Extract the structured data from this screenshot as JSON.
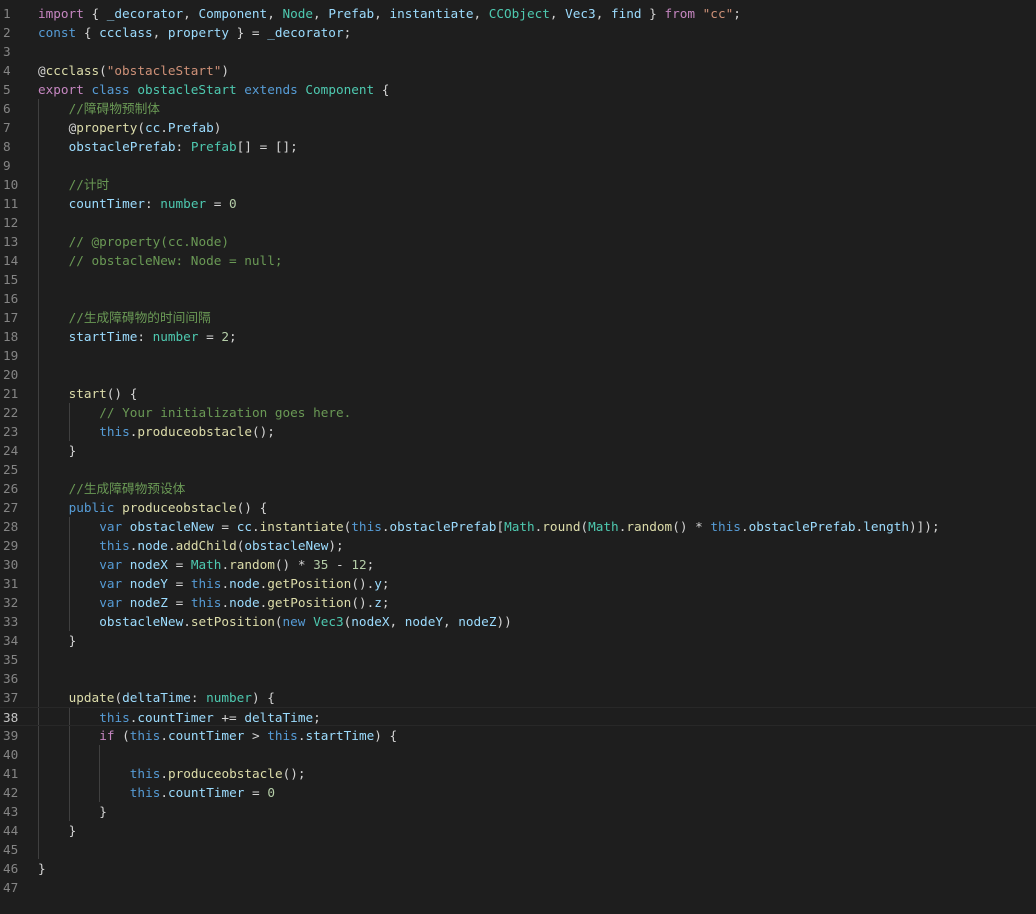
{
  "editor": {
    "language": "typescript",
    "current_line": 38,
    "theme_colors": {
      "background": "#1e1e1e",
      "keyword": "#569cd6",
      "control": "#c586c0",
      "string": "#ce9178",
      "variable": "#9cdcfe",
      "function": "#dcdcaa",
      "type": "#4ec9b0",
      "number": "#b5cea8",
      "comment": "#6a9955",
      "line_number": "#858585"
    },
    "lines": [
      {
        "n": "1",
        "indent": 0,
        "tokens": [
          [
            "import",
            "t-ctl"
          ],
          [
            " { ",
            "t-pun"
          ],
          [
            "_decorator",
            "t-var"
          ],
          [
            ", ",
            "t-pun"
          ],
          [
            "Component",
            "t-var"
          ],
          [
            ", ",
            "t-pun"
          ],
          [
            "Node",
            "t-type"
          ],
          [
            ", ",
            "t-pun"
          ],
          [
            "Prefab",
            "t-var"
          ],
          [
            ", ",
            "t-pun"
          ],
          [
            "instantiate",
            "t-var"
          ],
          [
            ", ",
            "t-pun"
          ],
          [
            "CCObject",
            "t-type"
          ],
          [
            ", ",
            "t-pun"
          ],
          [
            "Vec3",
            "t-var"
          ],
          [
            ", ",
            "t-pun"
          ],
          [
            "find",
            "t-var"
          ],
          [
            " } ",
            "t-pun"
          ],
          [
            "from",
            "t-ctl"
          ],
          [
            " ",
            "t-pun"
          ],
          [
            "\"cc\"",
            "t-str"
          ],
          [
            ";",
            "t-pun"
          ]
        ]
      },
      {
        "n": "2",
        "indent": 0,
        "tokens": [
          [
            "const",
            "t-kw"
          ],
          [
            " { ",
            "t-pun"
          ],
          [
            "ccclass",
            "t-var"
          ],
          [
            ", ",
            "t-pun"
          ],
          [
            "property",
            "t-var"
          ],
          [
            " } = ",
            "t-pun"
          ],
          [
            "_decorator",
            "t-var"
          ],
          [
            ";",
            "t-pun"
          ]
        ]
      },
      {
        "n": "3",
        "indent": 0,
        "tokens": []
      },
      {
        "n": "4",
        "indent": 0,
        "tokens": [
          [
            "@",
            "t-pun"
          ],
          [
            "ccclass",
            "t-fn"
          ],
          [
            "(",
            "t-pun"
          ],
          [
            "\"obstacleStart\"",
            "t-str"
          ],
          [
            ")",
            "t-pun"
          ]
        ]
      },
      {
        "n": "5",
        "indent": 0,
        "tokens": [
          [
            "export",
            "t-ctl"
          ],
          [
            " ",
            "t-pun"
          ],
          [
            "class",
            "t-kw"
          ],
          [
            " ",
            "t-pun"
          ],
          [
            "obstacleStart",
            "t-type"
          ],
          [
            " ",
            "t-pun"
          ],
          [
            "extends",
            "t-kw"
          ],
          [
            " ",
            "t-pun"
          ],
          [
            "Component",
            "t-type"
          ],
          [
            " {",
            "t-pun"
          ]
        ]
      },
      {
        "n": "6",
        "indent": 1,
        "tokens": [
          [
            "//障碍物预制体",
            "t-com"
          ]
        ]
      },
      {
        "n": "7",
        "indent": 1,
        "tokens": [
          [
            "@",
            "t-pun"
          ],
          [
            "property",
            "t-fn"
          ],
          [
            "(",
            "t-pun"
          ],
          [
            "cc",
            "t-var"
          ],
          [
            ".",
            "t-pun"
          ],
          [
            "Prefab",
            "t-var"
          ],
          [
            ")",
            "t-pun"
          ]
        ]
      },
      {
        "n": "8",
        "indent": 1,
        "tokens": [
          [
            "obstaclePrefab",
            "t-var"
          ],
          [
            ": ",
            "t-pun"
          ],
          [
            "Prefab",
            "t-type"
          ],
          [
            "[] = [];",
            "t-pun"
          ]
        ]
      },
      {
        "n": "9",
        "indent": 1,
        "tokens": []
      },
      {
        "n": "10",
        "indent": 1,
        "tokens": [
          [
            "//计时",
            "t-com"
          ]
        ]
      },
      {
        "n": "11",
        "indent": 1,
        "tokens": [
          [
            "countTimer",
            "t-var"
          ],
          [
            ": ",
            "t-pun"
          ],
          [
            "number",
            "t-type"
          ],
          [
            " = ",
            "t-pun"
          ],
          [
            "0",
            "t-num"
          ]
        ]
      },
      {
        "n": "12",
        "indent": 1,
        "tokens": []
      },
      {
        "n": "13",
        "indent": 1,
        "tokens": [
          [
            "// @property(cc.Node)",
            "t-com"
          ]
        ]
      },
      {
        "n": "14",
        "indent": 1,
        "tokens": [
          [
            "// obstacleNew: Node = null;",
            "t-com"
          ]
        ]
      },
      {
        "n": "15",
        "indent": 1,
        "tokens": []
      },
      {
        "n": "16",
        "indent": 1,
        "tokens": []
      },
      {
        "n": "17",
        "indent": 1,
        "tokens": [
          [
            "//生成障碍物的时间间隔",
            "t-com"
          ]
        ]
      },
      {
        "n": "18",
        "indent": 1,
        "tokens": [
          [
            "startTime",
            "t-var"
          ],
          [
            ": ",
            "t-pun"
          ],
          [
            "number",
            "t-type"
          ],
          [
            " = ",
            "t-pun"
          ],
          [
            "2",
            "t-num"
          ],
          [
            ";",
            "t-pun"
          ]
        ]
      },
      {
        "n": "19",
        "indent": 1,
        "tokens": []
      },
      {
        "n": "20",
        "indent": 1,
        "tokens": []
      },
      {
        "n": "21",
        "indent": 1,
        "tokens": [
          [
            "start",
            "t-fn"
          ],
          [
            "() {",
            "t-pun"
          ]
        ]
      },
      {
        "n": "22",
        "indent": 2,
        "tokens": [
          [
            "// Your initialization goes here.",
            "t-com"
          ]
        ]
      },
      {
        "n": "23",
        "indent": 2,
        "tokens": [
          [
            "this",
            "t-kw"
          ],
          [
            ".",
            "t-pun"
          ],
          [
            "produceobstacle",
            "t-fn"
          ],
          [
            "();",
            "t-pun"
          ]
        ]
      },
      {
        "n": "24",
        "indent": 1,
        "tokens": [
          [
            "}",
            "t-pun"
          ]
        ]
      },
      {
        "n": "25",
        "indent": 1,
        "tokens": []
      },
      {
        "n": "26",
        "indent": 1,
        "tokens": [
          [
            "//生成障碍物预设体",
            "t-com"
          ]
        ]
      },
      {
        "n": "27",
        "indent": 1,
        "tokens": [
          [
            "public",
            "t-kw"
          ],
          [
            " ",
            "t-pun"
          ],
          [
            "produceobstacle",
            "t-fn"
          ],
          [
            "() {",
            "t-pun"
          ]
        ]
      },
      {
        "n": "28",
        "indent": 2,
        "tokens": [
          [
            "var",
            "t-kw"
          ],
          [
            " ",
            "t-pun"
          ],
          [
            "obstacleNew",
            "t-var"
          ],
          [
            " = ",
            "t-pun"
          ],
          [
            "cc",
            "t-var"
          ],
          [
            ".",
            "t-pun"
          ],
          [
            "instantiate",
            "t-fn"
          ],
          [
            "(",
            "t-pun"
          ],
          [
            "this",
            "t-kw"
          ],
          [
            ".",
            "t-pun"
          ],
          [
            "obstaclePrefab",
            "t-var"
          ],
          [
            "[",
            "t-pun"
          ],
          [
            "Math",
            "t-type"
          ],
          [
            ".",
            "t-pun"
          ],
          [
            "round",
            "t-fn"
          ],
          [
            "(",
            "t-pun"
          ],
          [
            "Math",
            "t-type"
          ],
          [
            ".",
            "t-pun"
          ],
          [
            "random",
            "t-fn"
          ],
          [
            "() * ",
            "t-pun"
          ],
          [
            "this",
            "t-kw"
          ],
          [
            ".",
            "t-pun"
          ],
          [
            "obstaclePrefab",
            "t-var"
          ],
          [
            ".",
            "t-pun"
          ],
          [
            "length",
            "t-var"
          ],
          [
            ")]);",
            "t-pun"
          ]
        ]
      },
      {
        "n": "29",
        "indent": 2,
        "tokens": [
          [
            "this",
            "t-kw"
          ],
          [
            ".",
            "t-pun"
          ],
          [
            "node",
            "t-var"
          ],
          [
            ".",
            "t-pun"
          ],
          [
            "addChild",
            "t-fn"
          ],
          [
            "(",
            "t-pun"
          ],
          [
            "obstacleNew",
            "t-var"
          ],
          [
            ");",
            "t-pun"
          ]
        ]
      },
      {
        "n": "30",
        "indent": 2,
        "tokens": [
          [
            "var",
            "t-kw"
          ],
          [
            " ",
            "t-pun"
          ],
          [
            "nodeX",
            "t-var"
          ],
          [
            " = ",
            "t-pun"
          ],
          [
            "Math",
            "t-type"
          ],
          [
            ".",
            "t-pun"
          ],
          [
            "random",
            "t-fn"
          ],
          [
            "() * ",
            "t-pun"
          ],
          [
            "35",
            "t-num"
          ],
          [
            " - ",
            "t-pun"
          ],
          [
            "12",
            "t-num"
          ],
          [
            ";",
            "t-pun"
          ]
        ]
      },
      {
        "n": "31",
        "indent": 2,
        "tokens": [
          [
            "var",
            "t-kw"
          ],
          [
            " ",
            "t-pun"
          ],
          [
            "nodeY",
            "t-var"
          ],
          [
            " = ",
            "t-pun"
          ],
          [
            "this",
            "t-kw"
          ],
          [
            ".",
            "t-pun"
          ],
          [
            "node",
            "t-var"
          ],
          [
            ".",
            "t-pun"
          ],
          [
            "getPosition",
            "t-fn"
          ],
          [
            "().",
            "t-pun"
          ],
          [
            "y",
            "t-var"
          ],
          [
            ";",
            "t-pun"
          ]
        ]
      },
      {
        "n": "32",
        "indent": 2,
        "tokens": [
          [
            "var",
            "t-kw"
          ],
          [
            " ",
            "t-pun"
          ],
          [
            "nodeZ",
            "t-var"
          ],
          [
            " = ",
            "t-pun"
          ],
          [
            "this",
            "t-kw"
          ],
          [
            ".",
            "t-pun"
          ],
          [
            "node",
            "t-var"
          ],
          [
            ".",
            "t-pun"
          ],
          [
            "getPosition",
            "t-fn"
          ],
          [
            "().",
            "t-pun"
          ],
          [
            "z",
            "t-var"
          ],
          [
            ";",
            "t-pun"
          ]
        ]
      },
      {
        "n": "33",
        "indent": 2,
        "tokens": [
          [
            "obstacleNew",
            "t-var"
          ],
          [
            ".",
            "t-pun"
          ],
          [
            "setPosition",
            "t-fn"
          ],
          [
            "(",
            "t-pun"
          ],
          [
            "new",
            "t-kw"
          ],
          [
            " ",
            "t-pun"
          ],
          [
            "Vec3",
            "t-type"
          ],
          [
            "(",
            "t-pun"
          ],
          [
            "nodeX",
            "t-var"
          ],
          [
            ", ",
            "t-pun"
          ],
          [
            "nodeY",
            "t-var"
          ],
          [
            ", ",
            "t-pun"
          ],
          [
            "nodeZ",
            "t-var"
          ],
          [
            "))",
            "t-pun"
          ]
        ]
      },
      {
        "n": "34",
        "indent": 1,
        "tokens": [
          [
            "}",
            "t-pun"
          ]
        ]
      },
      {
        "n": "35",
        "indent": 1,
        "tokens": []
      },
      {
        "n": "36",
        "indent": 1,
        "tokens": []
      },
      {
        "n": "37",
        "indent": 1,
        "tokens": [
          [
            "update",
            "t-fn"
          ],
          [
            "(",
            "t-pun"
          ],
          [
            "deltaTime",
            "t-var"
          ],
          [
            ": ",
            "t-pun"
          ],
          [
            "number",
            "t-type"
          ],
          [
            ") {",
            "t-pun"
          ]
        ]
      },
      {
        "n": "38",
        "indent": 2,
        "tokens": [
          [
            "this",
            "t-kw"
          ],
          [
            ".",
            "t-pun"
          ],
          [
            "countTimer",
            "t-var"
          ],
          [
            " += ",
            "t-pun"
          ],
          [
            "deltaTime",
            "t-var"
          ],
          [
            ";",
            "t-pun"
          ]
        ]
      },
      {
        "n": "39",
        "indent": 2,
        "tokens": [
          [
            "if",
            "t-ctl"
          ],
          [
            " (",
            "t-pun"
          ],
          [
            "this",
            "t-kw"
          ],
          [
            ".",
            "t-pun"
          ],
          [
            "countTimer",
            "t-var"
          ],
          [
            " > ",
            "t-pun"
          ],
          [
            "this",
            "t-kw"
          ],
          [
            ".",
            "t-pun"
          ],
          [
            "startTime",
            "t-var"
          ],
          [
            ") {",
            "t-pun"
          ]
        ]
      },
      {
        "n": "40",
        "indent": 3,
        "tokens": []
      },
      {
        "n": "41",
        "indent": 3,
        "tokens": [
          [
            "this",
            "t-kw"
          ],
          [
            ".",
            "t-pun"
          ],
          [
            "produceobstacle",
            "t-fn"
          ],
          [
            "();",
            "t-pun"
          ]
        ]
      },
      {
        "n": "42",
        "indent": 3,
        "tokens": [
          [
            "this",
            "t-kw"
          ],
          [
            ".",
            "t-pun"
          ],
          [
            "countTimer",
            "t-var"
          ],
          [
            " = ",
            "t-pun"
          ],
          [
            "0",
            "t-num"
          ]
        ]
      },
      {
        "n": "43",
        "indent": 2,
        "tokens": [
          [
            "}",
            "t-pun"
          ]
        ]
      },
      {
        "n": "44",
        "indent": 1,
        "tokens": [
          [
            "}",
            "t-pun"
          ]
        ]
      },
      {
        "n": "45",
        "indent": 1,
        "tokens": []
      },
      {
        "n": "46",
        "indent": 0,
        "tokens": [
          [
            "}",
            "t-pun"
          ]
        ]
      },
      {
        "n": "47",
        "indent": 0,
        "tokens": []
      }
    ]
  }
}
